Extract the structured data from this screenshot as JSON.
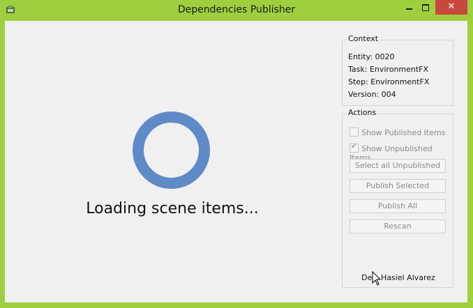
{
  "window": {
    "title": "Dependencies Publisher",
    "close_label": "✕"
  },
  "main": {
    "loading_text": "Loading scene items..."
  },
  "context": {
    "title": "Context",
    "entity": "Entity: 0020",
    "task": "Task: EnvironmentFX",
    "step": "Step: EnvironmentFX",
    "version": "Version: 004"
  },
  "actions": {
    "title": "Actions",
    "show_published": "Show Published Items",
    "show_published_checked": false,
    "show_unpublished": "Show Unpublished Items",
    "show_unpublished_checked": true,
    "select_all_unpublished": "Select all Unpublished",
    "publish_selected": "Publish Selected",
    "publish_all": "Publish All",
    "rescan": "Rescan"
  },
  "footer": {
    "author": "Dev. Hasiel Alvarez"
  },
  "colors": {
    "frame": "#9fcf3f",
    "spinner": "#5f8ac8",
    "close_button": "#c7483c"
  },
  "icons": [
    "app-icon",
    "minimize-icon",
    "maximize-icon",
    "close-icon",
    "loading-spinner-icon",
    "mouse-cursor-icon"
  ]
}
